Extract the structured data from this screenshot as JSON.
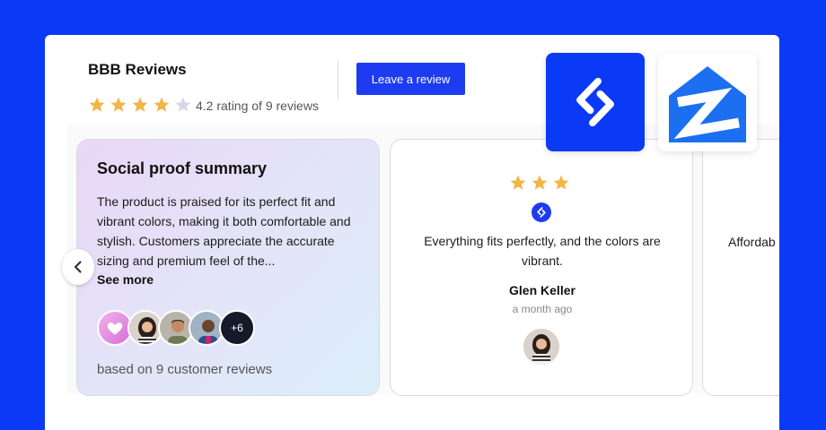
{
  "header": {
    "title": "BBB Reviews",
    "rating_text": "4.2 rating of 9 reviews",
    "rating": 4.2,
    "leave_review_label": "Leave a review"
  },
  "summary": {
    "title": "Social proof summary",
    "text": "The product is praised for its perfect fit and vibrant colors, making it both comfortable and stylish. Customers appreciate the accurate sizing and premium feel of the...",
    "see_more": "See more",
    "more_count": "+6",
    "based_on": "based on 9 customer reviews"
  },
  "reviews": [
    {
      "stars": 3,
      "text": "Everything fits perfectly, and the colors are vibrant.",
      "name": "Glen Keller",
      "time": "a month ago",
      "source_icon": "site-logo-icon"
    },
    {
      "text": "Affordab"
    }
  ],
  "logos": [
    "site-logo-icon",
    "zillow-icon"
  ],
  "colors": {
    "background": "#0a3af5",
    "accent": "#1d3cf2",
    "star": "#f2b546",
    "star_empty": "#d6d9e3"
  }
}
